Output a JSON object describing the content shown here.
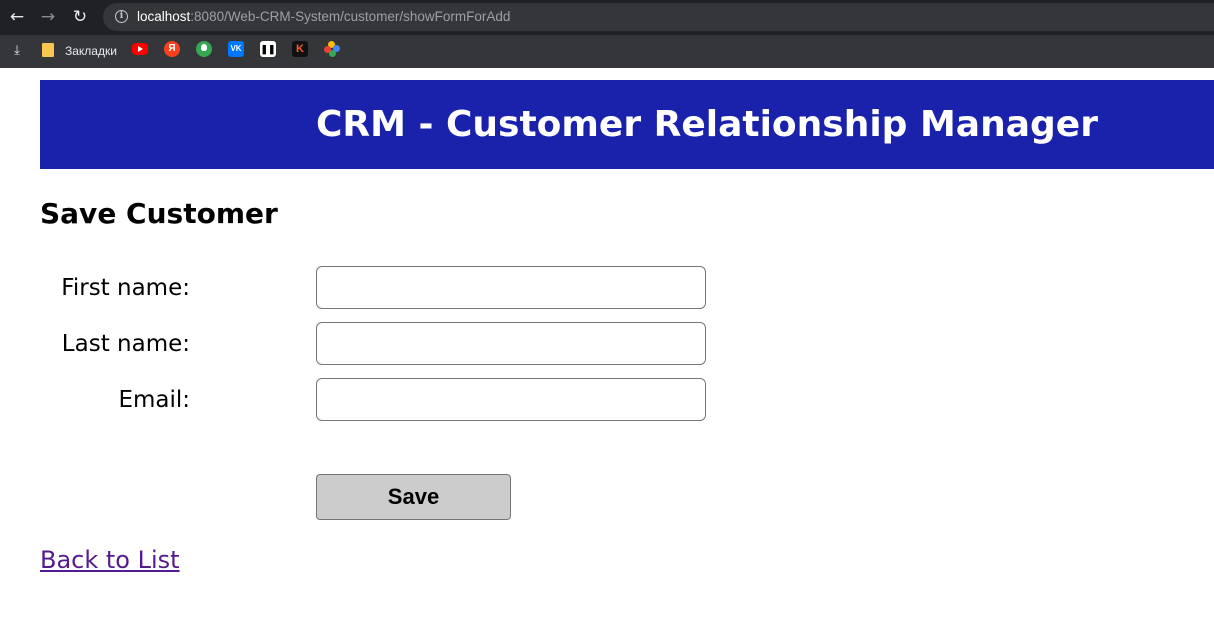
{
  "browser": {
    "url_host": "localhost",
    "url_path": ":8080/Web-CRM-System/customer/showFormForAdd",
    "bookmarks_folder_label": "Закладки",
    "bookmark_icons": [
      "youtube-icon",
      "yandex-icon",
      "green-leaf-icon",
      "vk-icon",
      "pause-app-icon",
      "k-app-icon",
      "pinwheel-icon"
    ]
  },
  "header": {
    "title": "CRM - Customer Relationship Manager",
    "background_color": "#1a22ab"
  },
  "page": {
    "heading": "Save Customer"
  },
  "form": {
    "fields": [
      {
        "label": "First name:",
        "value": ""
      },
      {
        "label": "Last name:",
        "value": ""
      },
      {
        "label": "Email:",
        "value": ""
      }
    ],
    "save_label": "Save"
  },
  "links": {
    "back": "Back to List",
    "back_color": "#551a8b"
  }
}
